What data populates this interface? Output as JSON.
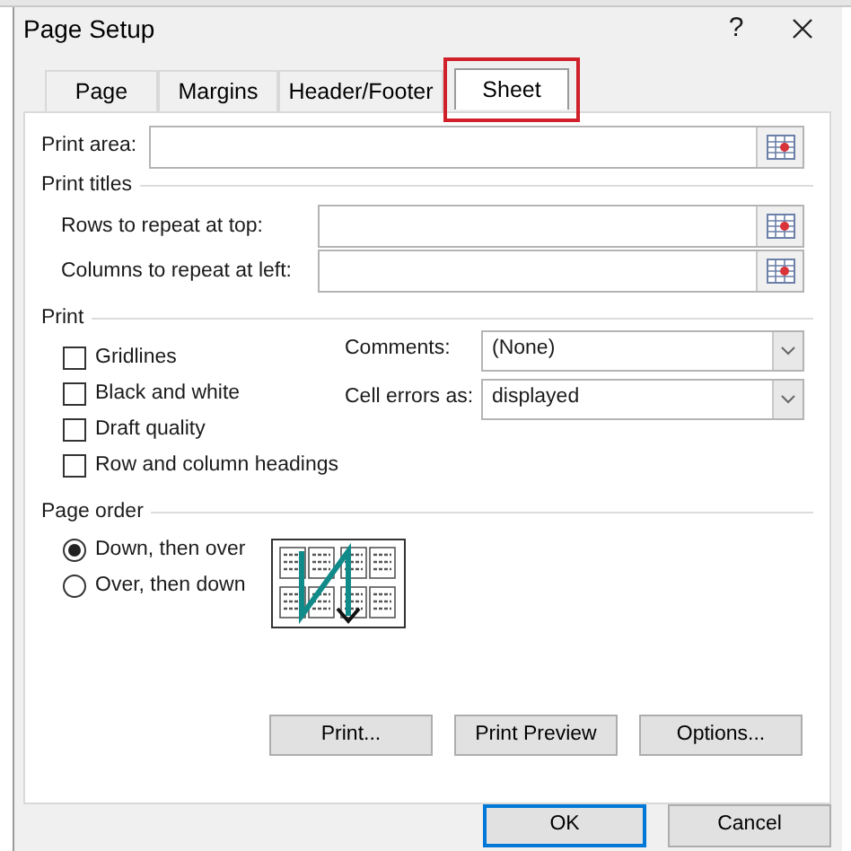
{
  "window": {
    "title": "Page Setup",
    "help": "?"
  },
  "tabs": [
    {
      "label": "Page",
      "selected": false,
      "highlighted": false
    },
    {
      "label": "Margins",
      "selected": false,
      "highlighted": false
    },
    {
      "label": "Header/Footer",
      "selected": false,
      "highlighted": false
    },
    {
      "label": "Sheet",
      "selected": true,
      "highlighted": true
    }
  ],
  "print_area": {
    "label": "Print area:"
  },
  "print_titles": {
    "heading": "Print titles",
    "fields": [
      {
        "label": "Rows to repeat at top:"
      },
      {
        "label": "Columns to repeat at left:"
      }
    ]
  },
  "print": {
    "heading": "Print",
    "options": [
      {
        "label": "Gridlines",
        "checked": false
      },
      {
        "label": "Black and white",
        "checked": false
      },
      {
        "label": "Draft quality",
        "checked": false
      },
      {
        "label": "Row and column headings",
        "checked": false
      }
    ],
    "dropdowns": [
      {
        "label": "Comments:",
        "value": "(None)"
      },
      {
        "label": "Cell errors as:",
        "value": "displayed"
      }
    ]
  },
  "page_order": {
    "heading": "Page order",
    "options": [
      {
        "label": "Down, then over",
        "selected": true
      },
      {
        "label": "Over, then down",
        "selected": false
      }
    ]
  },
  "buttons": [
    "Print...",
    "Print Preview",
    "Options..."
  ],
  "dialog_buttons": [
    {
      "label": "OK",
      "default": true
    },
    {
      "label": "Cancel",
      "default": false
    }
  ]
}
